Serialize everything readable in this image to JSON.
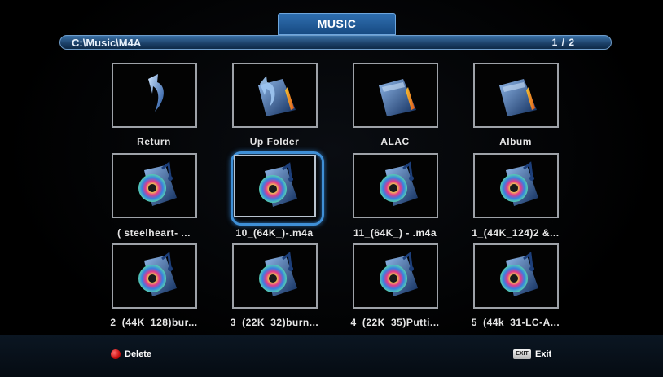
{
  "header": {
    "title": "MUSIC"
  },
  "path_bar": {
    "path": "C:\\Music\\M4A",
    "page": "1 / 2"
  },
  "grid": {
    "items": [
      {
        "label": "Return",
        "icon": "return-arrow-icon"
      },
      {
        "label": "Up Folder",
        "icon": "up-folder-icon"
      },
      {
        "label": "ALAC",
        "icon": "folder-icon"
      },
      {
        "label": "Album",
        "icon": "folder-icon"
      },
      {
        "label": "( steelheart-     ...",
        "icon": "music-file-icon"
      },
      {
        "label": "10_(64K_)-.m4a",
        "icon": "music-file-icon",
        "selected": true
      },
      {
        "label": "11_(64K_) - .m4a",
        "icon": "music-file-icon"
      },
      {
        "label": "1_(44K_124)2 &...",
        "icon": "music-file-icon"
      },
      {
        "label": "2_(44K_128)bur...",
        "icon": "music-file-icon"
      },
      {
        "label": "3_(22K_32)burn...",
        "icon": "music-file-icon"
      },
      {
        "label": "4_(22K_35)Putti...",
        "icon": "music-file-icon"
      },
      {
        "label": "5_(44k_31-LC-A...",
        "icon": "music-file-icon"
      }
    ]
  },
  "footer": {
    "delete_label": "Delete",
    "exit_key": "EXIT",
    "exit_label": "Exit"
  },
  "colors": {
    "accent": "#2f6fb0",
    "selection": "#3f8fd6",
    "delete_button": "#c81010"
  }
}
